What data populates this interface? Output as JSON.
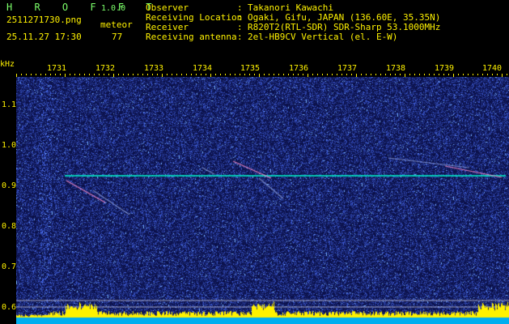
{
  "header": {
    "app_title": "H R O F F T",
    "version": "1.0.0",
    "filename": "2511271730.png",
    "meteor_label": "meteor",
    "datetime": "25.11.27 17:30",
    "meteor_count": "77"
  },
  "metadata": [
    {
      "label": "Observer",
      "value": "Takanori Kawachi"
    },
    {
      "label": "Receiving Location",
      "value": "Ogaki, Gifu, JAPAN (136.60E, 35.35N)"
    },
    {
      "label": "Receiver",
      "value": "R820T2(RTL-SDR) SDR-Sharp 53.1000MHz"
    },
    {
      "label": "Receiving antenna",
      "value": "2el-HB9CV Vertical (el. E-W)"
    }
  ],
  "axes": {
    "frequency_unit": "kHz",
    "time_ticks": [
      "1731",
      "1732",
      "1733",
      "1734",
      "1735",
      "1736",
      "1737",
      "1738",
      "1739",
      "1740"
    ],
    "freq_ticks": [
      "1.1",
      "1.0",
      "0.9",
      "0.8",
      "0.7",
      "0.6"
    ]
  },
  "colors": {
    "header_green": "#7CFF6A",
    "header_yellow": "#FFF200",
    "background_noise": "#10105A",
    "carrier_line": "#00FFD0",
    "activity_bar": "#FFF200"
  }
}
